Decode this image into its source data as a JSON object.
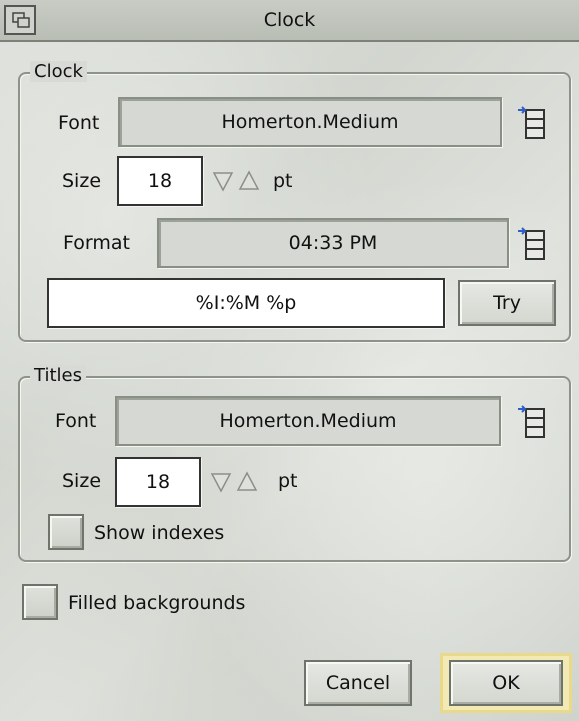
{
  "window": {
    "title": "Clock"
  },
  "clock_group": {
    "label": "Clock",
    "font_label": "Font",
    "font_value": "Homerton.Medium",
    "size_label": "Size",
    "size_value": "18",
    "unit": "pt",
    "format_label": "Format",
    "format_preview": "04:33 PM",
    "format_string": "%I:%M %p",
    "try_label": "Try"
  },
  "titles_group": {
    "label": "Titles",
    "font_label": "Font",
    "font_value": "Homerton.Medium",
    "size_label": "Size",
    "size_value": "18",
    "unit": "pt",
    "show_indexes_label": "Show indexes",
    "show_indexes_checked": false
  },
  "filled_backgrounds_label": "Filled backgrounds",
  "filled_backgrounds_checked": false,
  "buttons": {
    "cancel": "Cancel",
    "ok": "OK"
  },
  "colors": {
    "ok_highlight": "#f2e9b4",
    "window_bg": "#d9dcd6"
  }
}
